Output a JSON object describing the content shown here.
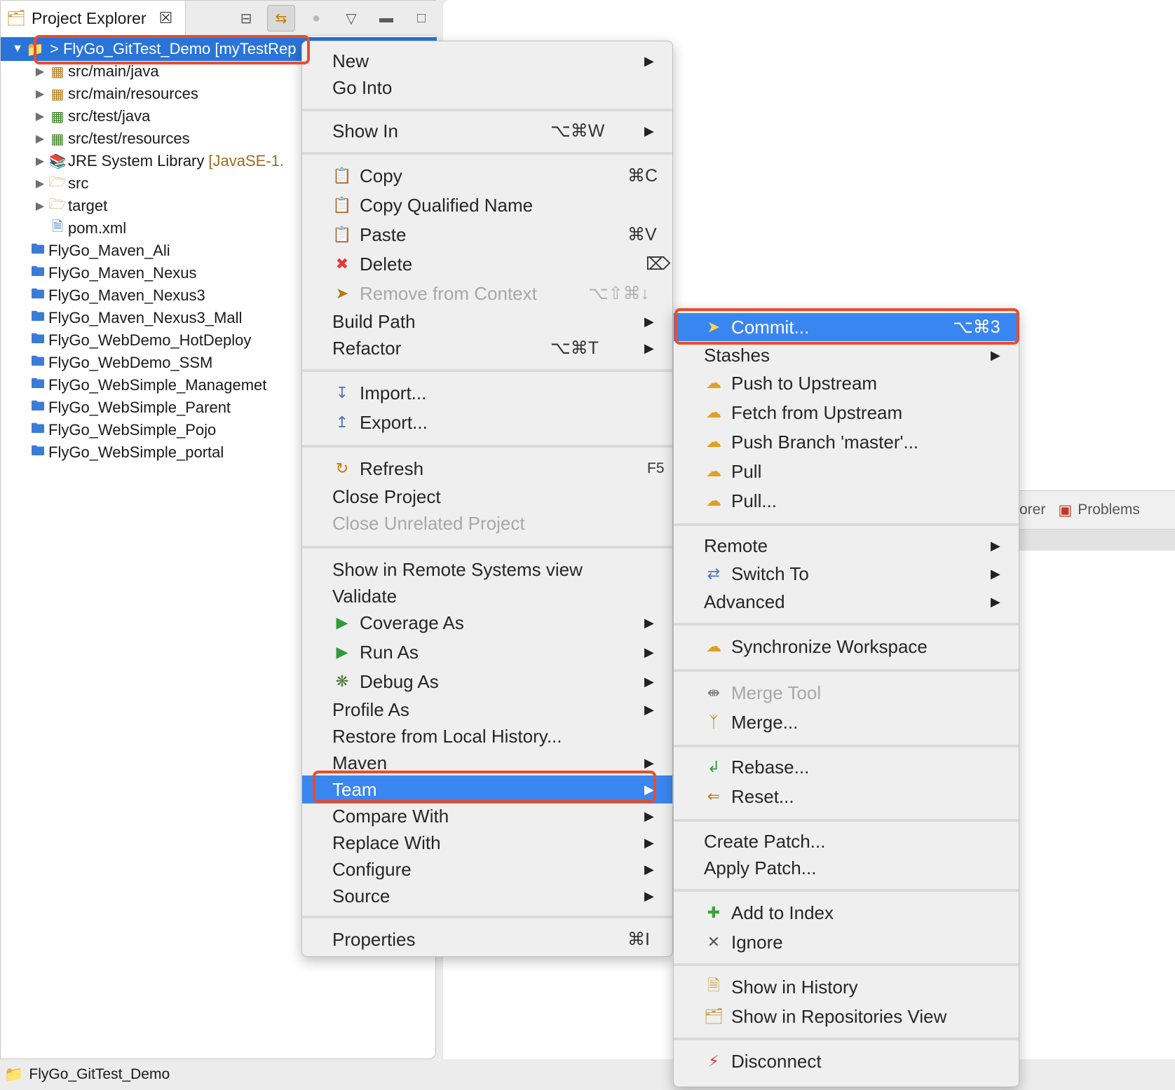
{
  "explorer": {
    "tab_label": "Project Explorer",
    "close_glyph": "☒",
    "toolbar": {
      "collapse_icon": "collapse-all-icon",
      "link_icon": "link-with-editor-icon",
      "focus_icon": "focus-icon",
      "view_menu_icon": "view-menu-icon",
      "minimize_icon": "minimize-icon",
      "maximize_icon": "maximize-icon"
    },
    "tree": {
      "selected_project": "> FlyGo_GitTest_Demo [myTestRep",
      "children": [
        {
          "label": "src/main/java",
          "icon": "package-folder-icon"
        },
        {
          "label": "src/main/resources",
          "icon": "package-folder-icon"
        },
        {
          "label": "src/test/java",
          "icon": "test-package-folder-icon"
        },
        {
          "label": "src/test/resources",
          "icon": "test-package-folder-icon"
        },
        {
          "label": "JRE System Library",
          "suffix": "[JavaSE-1.",
          "icon": "library-icon"
        },
        {
          "label": "src",
          "icon": "folder-icon"
        },
        {
          "label": "target",
          "icon": "folder-icon"
        },
        {
          "label": "pom.xml",
          "icon": "maven-file-icon"
        }
      ],
      "projects": [
        "FlyGo_Maven_Ali",
        "FlyGo_Maven_Nexus",
        "FlyGo_Maven_Nexus3",
        "FlyGo_Maven_Nexus3_Mall",
        "FlyGo_WebDemo_HotDeploy",
        "FlyGo_WebDemo_SSM",
        "FlyGo_WebSimple_Managemet",
        "FlyGo_WebSimple_Parent",
        "FlyGo_WebSimple_Pojo",
        "FlyGo_WebSimple_portal"
      ]
    }
  },
  "bottom_tabs": {
    "partial": "orer",
    "problems": "Problems"
  },
  "status_bar": {
    "text": "FlyGo_GitTest_Demo"
  },
  "context_menu": {
    "new": "New",
    "go_into": "Go Into",
    "show_in": "Show In",
    "show_in_shortcut": "⌥⌘W",
    "copy": "Copy",
    "copy_shortcut": "⌘C",
    "copy_qualified": "Copy Qualified Name",
    "paste": "Paste",
    "paste_shortcut": "⌘V",
    "delete": "Delete",
    "delete_shortcut": "⌦",
    "remove_context": "Remove from Context",
    "remove_context_shortcut": "⌥⇧⌘↓",
    "build_path": "Build Path",
    "refactor": "Refactor",
    "refactor_shortcut": "⌥⌘T",
    "import": "Import...",
    "export": "Export...",
    "refresh": "Refresh",
    "refresh_shortcut": "F5",
    "close_project": "Close Project",
    "close_unrelated": "Close Unrelated Project",
    "show_remote": "Show in Remote Systems view",
    "validate": "Validate",
    "coverage_as": "Coverage As",
    "run_as": "Run As",
    "debug_as": "Debug As",
    "profile_as": "Profile As",
    "restore_history": "Restore from Local History...",
    "maven": "Maven",
    "team": "Team",
    "compare_with": "Compare With",
    "replace_with": "Replace With",
    "configure": "Configure",
    "source": "Source",
    "properties": "Properties",
    "properties_shortcut": "⌘I"
  },
  "team_menu": {
    "commit": "Commit...",
    "commit_shortcut": "⌥⌘3",
    "stashes": "Stashes",
    "push_upstream": "Push to Upstream",
    "fetch_upstream": "Fetch from Upstream",
    "push_branch": "Push Branch 'master'...",
    "pull": "Pull",
    "pull_dialog": "Pull...",
    "remote": "Remote",
    "switch_to": "Switch To",
    "advanced": "Advanced",
    "synchronize": "Synchronize Workspace",
    "merge_tool": "Merge Tool",
    "merge": "Merge...",
    "rebase": "Rebase...",
    "reset": "Reset...",
    "create_patch": "Create Patch...",
    "apply_patch": "Apply Patch...",
    "add_index": "Add to Index",
    "ignore": "Ignore",
    "show_history": "Show in History",
    "show_repos": "Show in Repositories View",
    "disconnect": "Disconnect"
  },
  "colors": {
    "selection": "#3a86f0",
    "callout": "#e84d2c"
  }
}
